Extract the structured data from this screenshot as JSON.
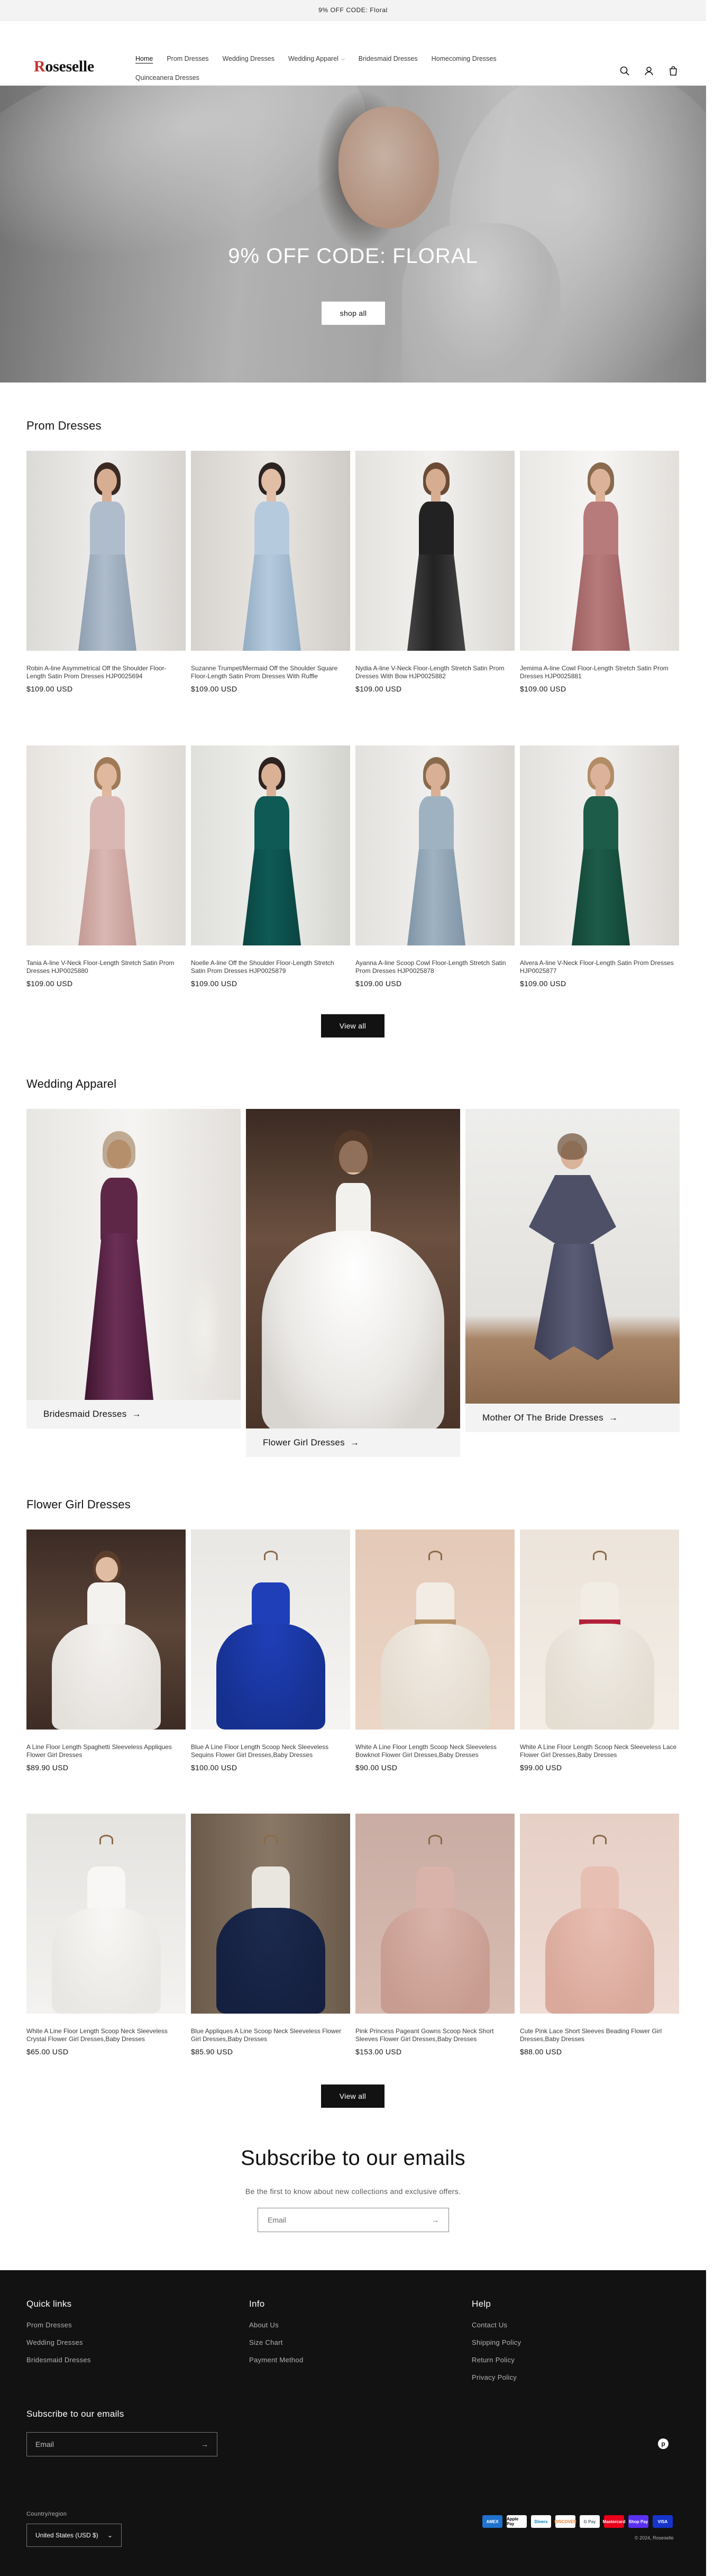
{
  "announcement": "9% OFF CODE: Floral",
  "header": {
    "logo_initial": "R",
    "logo_rest": "oseselle",
    "nav": [
      "Home",
      "Prom Dresses",
      "Wedding Dresses",
      "Wedding Apparel",
      "Bridesmaid Dresses",
      "Homecoming Dresses",
      "Quinceanera Dresses"
    ],
    "icons": [
      "search-icon",
      "account-icon",
      "cart-icon"
    ]
  },
  "hero": {
    "title": "9% OFF CODE: FLORAL",
    "button": "shop all"
  },
  "prom": {
    "title": "Prom Dresses",
    "view_all": "View all",
    "products": [
      {
        "name": "Robin A-line Asymmetrical Off the Shoulder Floor-Length Satin Prom Dresses HJP0025694",
        "price": "$109.00 USD"
      },
      {
        "name": "Suzanne Trumpet/Mermaid Off the Shoulder Square Floor-Length Satin Prom Dresses With Ruffle HJP0025863",
        "price": "$109.00 USD"
      },
      {
        "name": "Nydia A-line V-Neck Floor-Length Stretch Satin Prom Dresses With Bow HJP0025882",
        "price": "$109.00 USD"
      },
      {
        "name": "Jemima A-line Cowl Floor-Length Stretch Satin Prom Dresses HJP0025881",
        "price": "$109.00 USD"
      },
      {
        "name": "Tania A-line V-Neck Floor-Length Stretch Satin Prom Dresses HJP0025880",
        "price": "$109.00 USD"
      },
      {
        "name": "Noelle A-line Off the Shoulder Floor-Length Stretch Satin Prom Dresses HJP0025879",
        "price": "$109.00 USD"
      },
      {
        "name": "Ayanna A-line Scoop Cowl Floor-Length Stretch Satin Prom Dresses HJP0025878",
        "price": "$109.00 USD"
      },
      {
        "name": "Alvera A-line V-Neck Floor-Length Satin Prom Dresses HJP0025877",
        "price": "$109.00 USD"
      }
    ]
  },
  "apparel": {
    "title": "Wedding Apparel",
    "collections": [
      "Bridesmaid Dresses",
      "Flower Girl Dresses",
      "Mother Of The Bride Dresses"
    ]
  },
  "flower": {
    "title": "Flower Girl Dresses",
    "view_all": "View all",
    "products": [
      {
        "name": "A Line Floor Length Spaghetti Sleeveless Appliques Flower Girl Dresses",
        "price": "$89.90 USD"
      },
      {
        "name": "Blue A Line Floor Length Scoop Neck Sleeveless Sequins Flower Girl Dresses,Baby Dresses",
        "price": "$100.00 USD"
      },
      {
        "name": "White A Line Floor Length Scoop Neck Sleeveless Bowknot Flower Girl Dresses,Baby Dresses",
        "price": "$90.00 USD"
      },
      {
        "name": "White A Line Floor Length Scoop Neck Sleeveless Lace Flower Girl Dresses,Baby Dresses",
        "price": "$99.00 USD"
      },
      {
        "name": "White A Line Floor Length Scoop Neck Sleeveless Crystal Flower Girl Dresses,Baby Dresses",
        "price": "$65.00 USD"
      },
      {
        "name": "Blue Appliques A Line Scoop Neck Sleeveless Flower Girl Dresses,Baby Dresses",
        "price": "$85.90 USD"
      },
      {
        "name": "Pink Princess Pageant Gowns Scoop Neck Short Sleeves Flower Girl Dresses,Baby Dresses",
        "price": "$153.00 USD"
      },
      {
        "name": "Cute Pink Lace Short Sleeves Beading Flower Girl Dresses,Baby Dresses",
        "price": "$88.00 USD"
      }
    ]
  },
  "subscribe": {
    "title": "Subscribe to our emails",
    "text": "Be the first to know about new collections and exclusive offers.",
    "placeholder": "Email"
  },
  "footer": {
    "quick_links": {
      "title": "Quick links",
      "items": [
        "Prom Dresses",
        "Wedding Dresses",
        "Bridesmaid Dresses"
      ]
    },
    "info": {
      "title": "Info",
      "items": [
        "About Us",
        "Size Chart",
        "Payment Method"
      ]
    },
    "help": {
      "title": "Help",
      "items": [
        "Contact Us",
        "Shipping Policy",
        "Return Policy",
        "Privacy Policy"
      ]
    },
    "subscribe_title": "Subscribe to our emails",
    "email_placeholder": "Email",
    "country_label": "Country/region",
    "country_value": "United States (USD $)",
    "copyright": "© 2024, Roseselle",
    "payments": [
      "AMEX",
      "Apple Pay",
      "Diners",
      "DISCOVER",
      "G Pay",
      "Mastercard",
      "Shop Pay",
      "VISA"
    ],
    "social_icon": "pinterest-icon"
  }
}
